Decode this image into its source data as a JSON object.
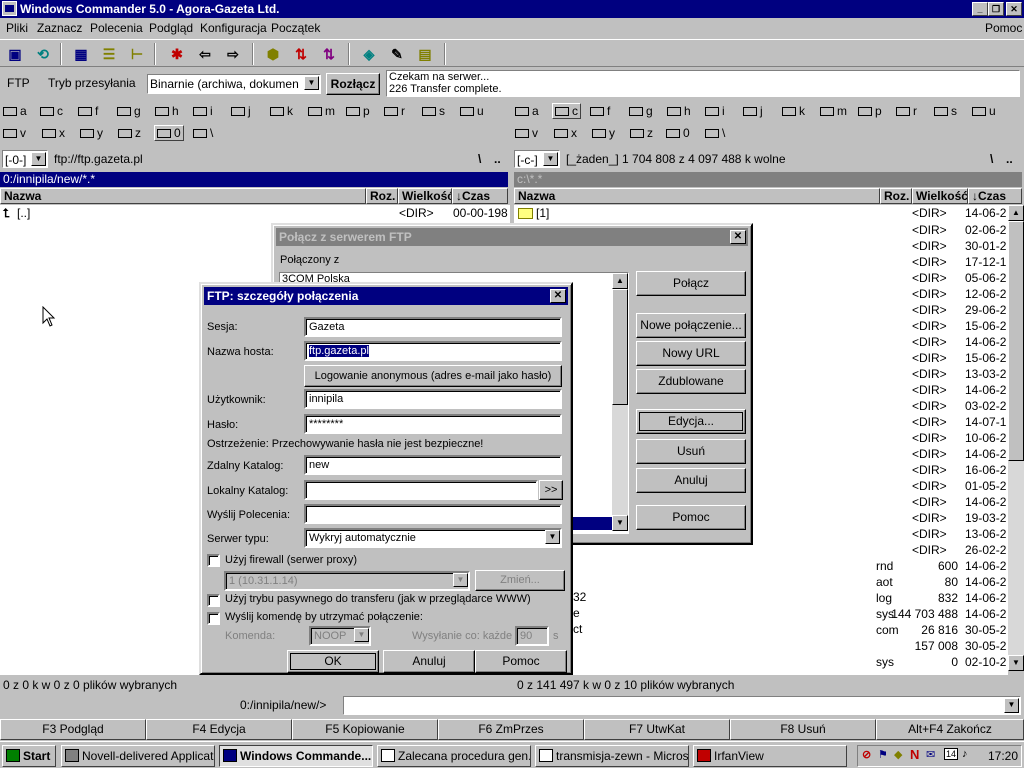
{
  "window": {
    "title": "Windows Commander 5.0 - Agora-Gazeta Ltd."
  },
  "menu": {
    "items": [
      "Pliki",
      "Zaznacz",
      "Polecenia",
      "Podgląd",
      "Konfiguracja",
      "Początek"
    ],
    "help": "Pomoc"
  },
  "ftp_bar": {
    "label": "FTP",
    "mode_label": "Tryb przesyłania",
    "mode_value": "Binarnie (archiwa, dokumen",
    "disconnect_button": "Rozłącz",
    "log_lines": [
      "Czekam na serwer...",
      "226 Transfer complete."
    ]
  },
  "drives": {
    "row1": [
      "a",
      "c",
      "f",
      "g",
      "h",
      "i",
      "j",
      "k",
      "m",
      "p",
      "r",
      "s",
      "u"
    ],
    "row2": [
      "v",
      "x",
      "y",
      "z",
      "0",
      "\\"
    ]
  },
  "left_panel": {
    "drive_select": "[-0-]",
    "path_info": "ftp://ftp.gazeta.pl",
    "header_path": "0:/innipila/new/*.*",
    "columns": [
      "Nazwa",
      "Roz.",
      "Wielkość",
      "↓Czas"
    ],
    "rows": [
      {
        "name": "[..]",
        "size": "<DIR>",
        "date": "00-00-198"
      }
    ],
    "status": "0 z 0 k w 0 z 0 plików wybranych"
  },
  "right_panel": {
    "drive_select": "[-c-]",
    "path_info": "[_żaden_]  1 704 808 z 4 097 488 k wolne",
    "header_path": "c:\\*.*",
    "columns": [
      "Nazwa",
      "Roz.",
      "Wielkość",
      "↓Czas"
    ],
    "rows": [
      {
        "name": "[1]",
        "ext": "",
        "size": "<DIR>",
        "date": "14-06-2"
      },
      {
        "name": "",
        "ext": "",
        "size": "<DIR>",
        "date": "02-06-2"
      },
      {
        "name": "",
        "ext": "",
        "size": "<DIR>",
        "date": "30-01-2"
      },
      {
        "name": "",
        "ext": "",
        "size": "<DIR>",
        "date": "17-12-1"
      },
      {
        "name": "",
        "ext": "",
        "size": "<DIR>",
        "date": "05-06-2"
      },
      {
        "name": "",
        "ext": "",
        "size": "<DIR>",
        "date": "12-06-2"
      },
      {
        "name": "",
        "ext": "",
        "size": "<DIR>",
        "date": "29-06-2"
      },
      {
        "name": "",
        "ext": "",
        "size": "<DIR>",
        "date": "15-06-2"
      },
      {
        "name": "",
        "ext": "",
        "size": "<DIR>",
        "date": "14-06-2"
      },
      {
        "name": "",
        "ext": "",
        "size": "<DIR>",
        "date": "15-06-2"
      },
      {
        "name": "",
        "ext": "",
        "size": "<DIR>",
        "date": "13-03-2"
      },
      {
        "name": "",
        "ext": "",
        "size": "<DIR>",
        "date": "14-06-2"
      },
      {
        "name": "",
        "ext": "",
        "size": "<DIR>",
        "date": "03-02-2"
      },
      {
        "name": "",
        "ext": "",
        "size": "<DIR>",
        "date": "14-07-1"
      },
      {
        "name": "",
        "ext": "",
        "size": "<DIR>",
        "date": "10-06-2"
      },
      {
        "name": "",
        "ext": "",
        "size": "<DIR>",
        "date": "14-06-2"
      },
      {
        "name": "",
        "ext": "",
        "size": "<DIR>",
        "date": "16-06-2"
      },
      {
        "name": "",
        "ext": "",
        "size": "<DIR>",
        "date": "01-05-2"
      },
      {
        "name": "",
        "ext": "",
        "size": "<DIR>",
        "date": "14-06-2"
      },
      {
        "name": "",
        "ext": "",
        "size": "<DIR>",
        "date": "19-03-2"
      },
      {
        "name": "",
        "ext": "",
        "size": "<DIR>",
        "date": "13-06-2"
      },
      {
        "name": "",
        "ext": "",
        "size": "<DIR>",
        "date": "26-02-2"
      },
      {
        "name": "",
        "ext": "rnd",
        "size": "600",
        "date": "14-06-2"
      },
      {
        "name": "",
        "ext": "aot",
        "size": "80",
        "date": "14-06-2"
      },
      {
        "name": "",
        "ext": "log",
        "size": "832",
        "date": "14-06-2"
      },
      {
        "name": "",
        "ext": "sys",
        "size": "144 703 488",
        "date": "14-06-2"
      },
      {
        "name": "",
        "ext": "com",
        "size": "26 816",
        "date": "30-05-2"
      },
      {
        "name": "",
        "ext": "",
        "size": "157 008",
        "date": "30-05-2"
      },
      {
        "name": "",
        "ext": "sys",
        "size": "0",
        "date": "02-10-2"
      }
    ],
    "partial_names": [
      "]",
      "32",
      "e",
      "ct"
    ],
    "status": "0 z 141 497 k w 0 z 10 plików wybranych"
  },
  "cmdline": {
    "prompt": "0:/innipila/new/>",
    "value": ""
  },
  "fkeys": [
    "F3 Podgląd",
    "F4 Edycja",
    "F5 Kopiowanie",
    "F6 ZmPrzes",
    "F7 UtwKat",
    "F8 Usuń",
    "Alt+F4 Zakończ"
  ],
  "connect_dialog": {
    "title": "Połącz z serwerem FTP",
    "list_label": "Połączony z",
    "list_items": [
      "3COM Polska"
    ],
    "buttons": [
      "Połącz",
      "Nowe połączenie...",
      "Nowy URL",
      "Zdublowane",
      "Edycja...",
      "Usuń",
      "Anuluj",
      "Pomoc"
    ]
  },
  "details_dialog": {
    "title": "FTP: szczegóły połączenia",
    "session_label": "Sesja:",
    "session_value": "Gazeta",
    "host_label": "Nazwa hosta:",
    "host_value": "ftp.gazeta.pl",
    "anon_button": "Logowanie anonymous (adres e-mail jako hasło)",
    "user_label": "Użytkownik:",
    "user_value": "innipila",
    "password_label": "Hasło:",
    "password_value": "********",
    "warning": "Ostrzeżenie: Przechowywanie hasła nie jest bezpieczne!",
    "remote_dir_label": "Zdalny Katalog:",
    "remote_dir_value": "new",
    "local_dir_label": "Lokalny Katalog:",
    "local_dir_value": "",
    "browse_button": ">>",
    "commands_label": "Wyślij Polecenia:",
    "commands_value": "",
    "server_type_label": "Serwer typu:",
    "server_type_value": "Wykryj automatycznie",
    "firewall_label": "Użyj firewall (serwer proxy)",
    "firewall_value": "1 (10.31.1.14)",
    "change_button": "Zmień...",
    "passive_label": "Użyj trybu pasywnego do transferu (jak w przeglądarce WWW)",
    "keepalive_label": "Wyślij komendę by utrzymać połączenie:",
    "command_label": "Komenda:",
    "command_value": "NOOP",
    "interval_label": "Wysyłanie co: każde",
    "interval_value": "90",
    "interval_unit": "s",
    "ok_button": "OK",
    "cancel_button": "Anuluj",
    "help_button": "Pomoc"
  },
  "taskbar": {
    "start": "Start",
    "tasks": [
      "Novell-delivered Applicati...",
      "Windows Commande...",
      "Zalecana procedura gen...",
      "transmisja-zewn - Microso...",
      "IrfanView"
    ],
    "tray_badge": "14",
    "clock": "17:20"
  }
}
